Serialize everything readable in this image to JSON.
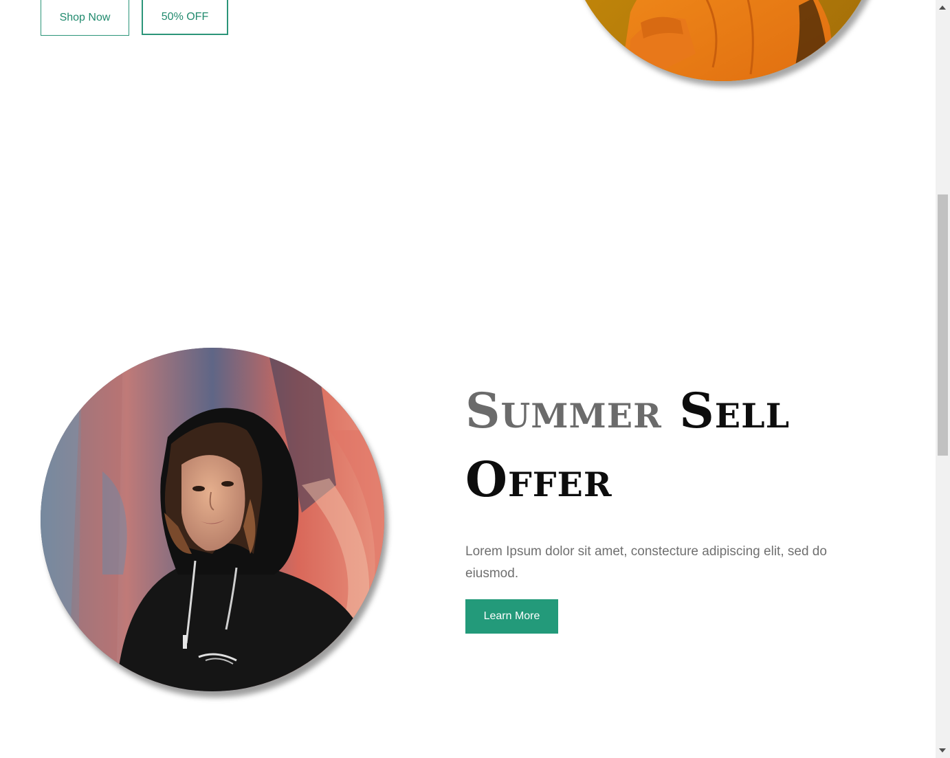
{
  "top_buttons": {
    "shop_now": "Shop Now",
    "discount": "50% OFF"
  },
  "hero_image": {
    "description_icon": "model-orange-hoodie-image"
  },
  "offer": {
    "image_icon": "model-black-hoodie-image",
    "title_part_grey": "Summer",
    "title_part_black_1": "Sell",
    "title_part_black_2": "Offer",
    "description": "Lorem Ipsum dolor sit amet, constecture adipiscing elit, sed do eiusmod.",
    "cta_label": "Learn More"
  },
  "colors": {
    "accent": "#239a7a",
    "outline_text": "#218a6e",
    "heading_grey": "#6b6b6b",
    "heading_black": "#0d0d0d",
    "body_text": "#6f6f6f"
  }
}
